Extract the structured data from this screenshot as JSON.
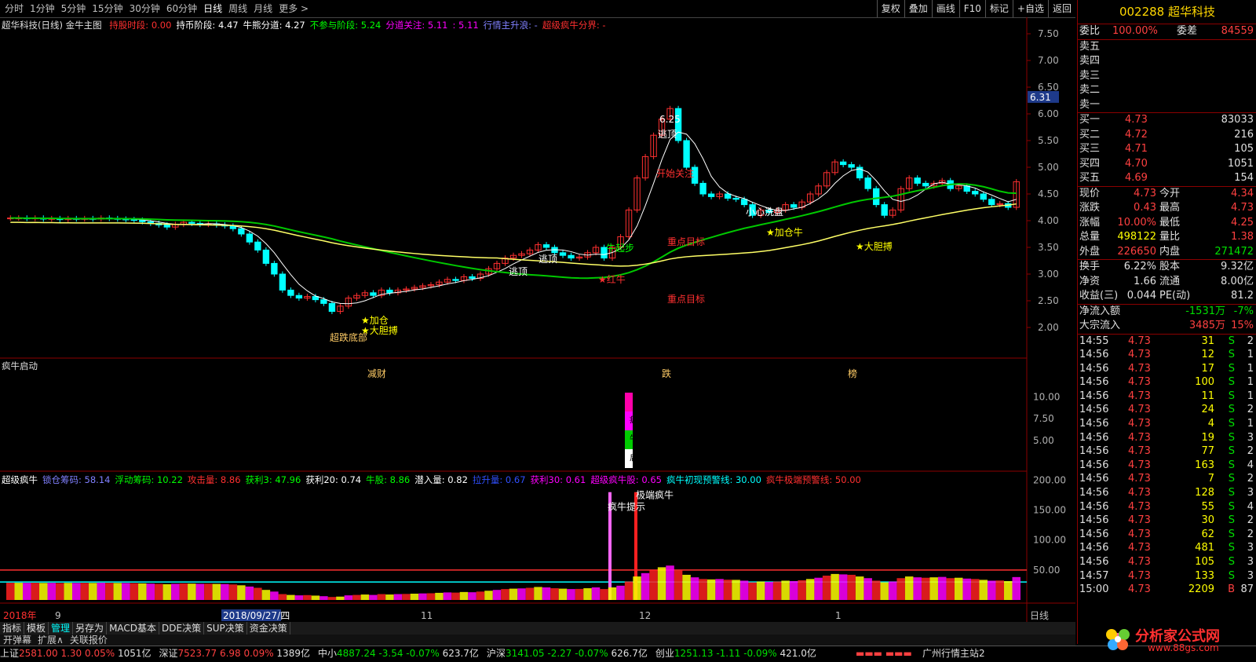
{
  "toolbar": {
    "timeframes": [
      "分时",
      "1分钟",
      "5分钟",
      "15分钟",
      "30分钟",
      "60分钟",
      "日线",
      "周线",
      "月线",
      "更多 >"
    ],
    "active": "日线",
    "right_buttons": [
      "复权",
      "叠加",
      "画线",
      "F10",
      "标记",
      "+自选",
      "返回"
    ]
  },
  "main_header": {
    "name": "超华科技(日线) 金牛主图",
    "items": [
      {
        "label": "持股时段: 0.00",
        "color": "#ff3030"
      },
      {
        "label": "持币阶段: 4.47",
        "color": "#ffffff"
      },
      {
        "label": "牛熊分道: 4.27",
        "color": "#ffffff"
      },
      {
        "label": "不参与阶段: 5.24",
        "color": "#00ff00"
      },
      {
        "label": "分道关注: 5.11",
        "color": "#ff00ff"
      },
      {
        "label": ": 5.11",
        "color": "#ff00ff"
      },
      {
        "label": "行情主升浪: -",
        "color": "#8080ff"
      },
      {
        "label": "超级疯牛分界: -",
        "color": "#ff3030"
      }
    ]
  },
  "price_axis": [
    "7.50",
    "7.00",
    "6.50",
    "6.00",
    "5.50",
    "5.00",
    "4.50",
    "4.00",
    "3.50",
    "3.00",
    "2.50",
    "2.00"
  ],
  "current_price_tag": "6.31",
  "annotations": {
    "peak": "6.25",
    "escape_top": "逃顶",
    "escape1": "逃顶",
    "escape2": "逃顶",
    "focus": "开始关注",
    "key_target1": "重点目标",
    "key_target2": "重点目标",
    "red_bull": "★红牛",
    "bull_start": "牛起步",
    "small_wash": "小心洗盘",
    "add_pos1": "★加仓",
    "add_pos2": "★加仓牛",
    "bold_bet1": "★大胆搏",
    "bold_bet2": "★大胆搏",
    "bottom": "超跌底部",
    "low_tag": "减财",
    "mid_tag": "跌",
    "right_tag": "榜"
  },
  "mid_panel": {
    "title": "疯牛启动",
    "axis": [
      "10.00",
      "7.50",
      "5.00"
    ],
    "bar_chars": [
      "疯",
      "牛",
      "启",
      "动"
    ]
  },
  "low_panel": {
    "header": [
      {
        "label": "超级疯牛",
        "color": "#ffffff"
      },
      {
        "label": "锁仓筹码: 58.14",
        "color": "#8080ff"
      },
      {
        "label": "浮动筹码: 10.22",
        "color": "#00ff00"
      },
      {
        "label": "攻击量: 8.86",
        "color": "#ff3030"
      },
      {
        "label": "获利3: 47.96",
        "color": "#00ff00"
      },
      {
        "label": "获利20: 0.74",
        "color": "#ffffff"
      },
      {
        "label": "牛股: 8.86",
        "color": "#00ff00"
      },
      {
        "label": "潜入量: 0.82",
        "color": "#ffffff"
      },
      {
        "label": "拉升量: 0.67",
        "color": "#3050ff"
      },
      {
        "label": "获利30: 0.61",
        "color": "#ff00ff"
      },
      {
        "label": "超级疯牛股: 0.65",
        "color": "#ff00ff"
      },
      {
        "label": "疯牛初现预警线: 30.00",
        "color": "#00ffff"
      },
      {
        "label": "疯牛极端预警线: 50.00",
        "color": "#ff3030"
      }
    ],
    "axis": [
      "200.00",
      "150.00",
      "100.00",
      "50.00"
    ],
    "hint1": "疯牛提示",
    "hint2": "极端疯牛"
  },
  "date_axis": {
    "labels": [
      "2018年",
      "9",
      "11",
      "12",
      "1",
      "日线"
    ],
    "cursor_date": "2018/09/27/四"
  },
  "tabs": [
    "指标",
    "模板",
    "管理",
    "另存为",
    "MACD基本",
    "DDE决策",
    "SUP决策",
    "资金决策"
  ],
  "active_tab": "管理",
  "subtabs": [
    "开弹幕",
    "扩展∧",
    "关联报价"
  ],
  "quote": {
    "code": "002288",
    "name": "超华科技",
    "ratio_label": "委比",
    "ratio": "100.00%",
    "diff_label": "委差",
    "diff": "84559",
    "asks": [
      {
        "label": "卖五",
        "price": "",
        "vol": ""
      },
      {
        "label": "卖四",
        "price": "",
        "vol": ""
      },
      {
        "label": "卖三",
        "price": "",
        "vol": ""
      },
      {
        "label": "卖二",
        "price": "",
        "vol": ""
      },
      {
        "label": "卖一",
        "price": "",
        "vol": ""
      }
    ],
    "bids": [
      {
        "label": "买一",
        "price": "4.73",
        "vol": "83033"
      },
      {
        "label": "买二",
        "price": "4.72",
        "vol": "216"
      },
      {
        "label": "买三",
        "price": "4.71",
        "vol": "105"
      },
      {
        "label": "买四",
        "price": "4.70",
        "vol": "1051"
      },
      {
        "label": "买五",
        "price": "4.69",
        "vol": "154"
      }
    ],
    "stats": [
      {
        "l1": "现价",
        "v1": "4.73",
        "c1": "red",
        "l2": "今开",
        "v2": "4.34",
        "c2": "red"
      },
      {
        "l1": "涨跌",
        "v1": "0.43",
        "c1": "red",
        "l2": "最高",
        "v2": "4.73",
        "c2": "red"
      },
      {
        "l1": "涨幅",
        "v1": "10.00%",
        "c1": "red",
        "l2": "最低",
        "v2": "4.25",
        "c2": "red"
      },
      {
        "l1": "总量",
        "v1": "498122",
        "c1": "yel",
        "l2": "量比",
        "v2": "1.38",
        "c2": "red"
      },
      {
        "l1": "外盘",
        "v1": "226650",
        "c1": "red",
        "l2": "内盘",
        "v2": "271472",
        "c2": "grn"
      }
    ],
    "stats2": [
      {
        "l1": "换手",
        "v1": "6.22%",
        "c1": "wht",
        "l2": "股本",
        "v2": "9.32亿",
        "c2": "wht"
      },
      {
        "l1": "净资",
        "v1": "1.66",
        "c1": "wht",
        "l2": "流通",
        "v2": "8.00亿",
        "c2": "wht"
      },
      {
        "l1": "收益(三)",
        "v1": "0.044",
        "c1": "wht",
        "l2": "PE(动)",
        "v2": "81.2",
        "c2": "wht"
      }
    ],
    "flow": [
      {
        "label": "净流入额",
        "value": "-1531万",
        "pct": "-7%",
        "color": "grn"
      },
      {
        "label": "大宗流入",
        "value": "3485万",
        "pct": "15%",
        "color": "red"
      }
    ],
    "ticks": [
      {
        "t": "14:55",
        "p": "4.73",
        "v": "31",
        "s": "S",
        "n": "2"
      },
      {
        "t": "14:56",
        "p": "4.73",
        "v": "12",
        "s": "S",
        "n": "1"
      },
      {
        "t": "14:56",
        "p": "4.73",
        "v": "17",
        "s": "S",
        "n": "1"
      },
      {
        "t": "14:56",
        "p": "4.73",
        "v": "100",
        "s": "S",
        "n": "1"
      },
      {
        "t": "14:56",
        "p": "4.73",
        "v": "11",
        "s": "S",
        "n": "1"
      },
      {
        "t": "14:56",
        "p": "4.73",
        "v": "24",
        "s": "S",
        "n": "2"
      },
      {
        "t": "14:56",
        "p": "4.73",
        "v": "4",
        "s": "S",
        "n": "1"
      },
      {
        "t": "14:56",
        "p": "4.73",
        "v": "19",
        "s": "S",
        "n": "3"
      },
      {
        "t": "14:56",
        "p": "4.73",
        "v": "77",
        "s": "S",
        "n": "2"
      },
      {
        "t": "14:56",
        "p": "4.73",
        "v": "163",
        "s": "S",
        "n": "4"
      },
      {
        "t": "14:56",
        "p": "4.73",
        "v": "7",
        "s": "S",
        "n": "2"
      },
      {
        "t": "14:56",
        "p": "4.73",
        "v": "128",
        "s": "S",
        "n": "3"
      },
      {
        "t": "14:56",
        "p": "4.73",
        "v": "55",
        "s": "S",
        "n": "4"
      },
      {
        "t": "14:56",
        "p": "4.73",
        "v": "30",
        "s": "S",
        "n": "2"
      },
      {
        "t": "14:56",
        "p": "4.73",
        "v": "62",
        "s": "S",
        "n": "2"
      },
      {
        "t": "14:56",
        "p": "4.73",
        "v": "481",
        "s": "S",
        "n": "3"
      },
      {
        "t": "14:56",
        "p": "4.73",
        "v": "105",
        "s": "S",
        "n": "3"
      },
      {
        "t": "14:57",
        "p": "4.73",
        "v": "133",
        "s": "S",
        "n": "3"
      },
      {
        "t": "15:00",
        "p": "4.73",
        "v": "2209",
        "s": "B",
        "n": "87"
      }
    ]
  },
  "status_bar": [
    {
      "name": "上证",
      "val": "2581.00",
      "chg": "1.30",
      "pct": "0.05%",
      "amt": "1051亿",
      "color": "red"
    },
    {
      "name": "深证",
      "val": "7523.77",
      "chg": "6.98",
      "pct": "0.09%",
      "amt": "1389亿",
      "color": "red"
    },
    {
      "name": "中小",
      "val": "4887.24",
      "chg": "-3.54",
      "pct": "-0.07%",
      "amt": "623.7亿",
      "color": "grn"
    },
    {
      "name": "沪深",
      "val": "3141.05",
      "chg": "-2.27",
      "pct": "-0.07%",
      "amt": "626.7亿",
      "color": "grn"
    },
    {
      "name": "创业",
      "val": "1251.13",
      "chg": "-1.11",
      "pct": "-0.09%",
      "amt": "421.0亿",
      "color": "grn"
    }
  ],
  "server": "广州行情主站2",
  "watermark": {
    "name": "分析家公式网",
    "url": "www.88gs.com"
  }
}
